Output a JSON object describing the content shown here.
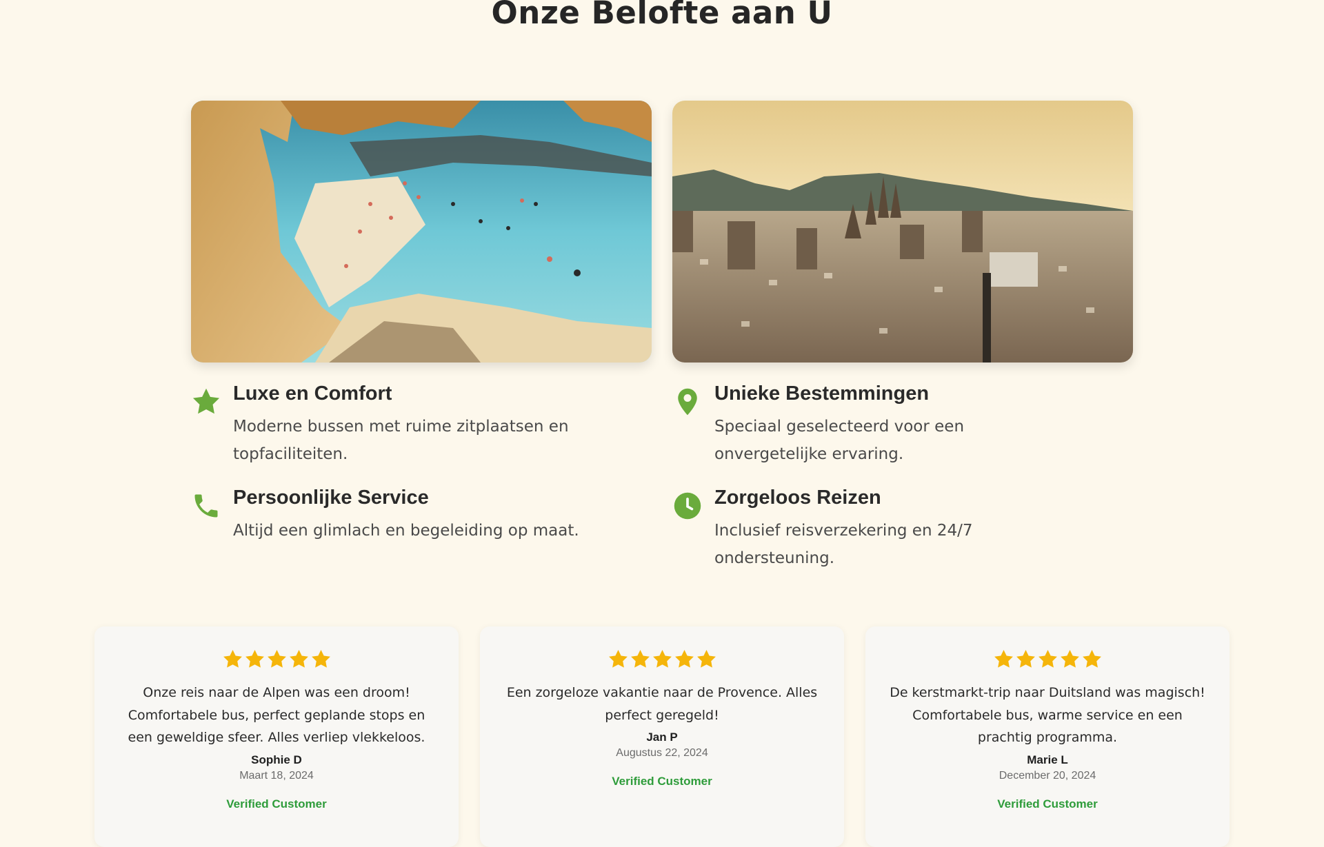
{
  "section": {
    "title": "Onze Belofte aan U"
  },
  "photos": [
    {
      "icon": "beach-cove-photo"
    },
    {
      "icon": "city-skyline-photo"
    }
  ],
  "features": [
    {
      "icon": "star-icon",
      "title": "Luxe en Comfort",
      "description": "Moderne bussen met ruime zitplaatsen en topfaciliteiten."
    },
    {
      "icon": "map-pin-icon",
      "title": "Unieke Bestemmingen",
      "description": "Speciaal geselecteerd voor een onvergetelijke ervaring."
    },
    {
      "icon": "phone-icon",
      "title": "Persoonlijke Service",
      "description": "Altijd een glimlach en begeleiding op maat."
    },
    {
      "icon": "clock-icon",
      "title": "Zorgeloos Reizen",
      "description": "Inclusief reisverzekering en 24/7 ondersteuning."
    }
  ],
  "reviews": [
    {
      "rating": 5,
      "text": "Onze reis naar de Alpen was een droom! Comfortabele bus, perfect geplande stops en een geweldige sfeer. Alles verliep vlekkeloos.",
      "name": "Sophie D",
      "date": "Maart 18, 2024",
      "badge": "Verified Customer"
    },
    {
      "rating": 5,
      "text": "Een zorgeloze vakantie naar de Provence. Alles perfect geregeld!",
      "name": "Jan P",
      "date": "Augustus 22, 2024",
      "badge": "Verified Customer"
    },
    {
      "rating": 5,
      "text": "De kerstmarkt-trip naar Duitsland was magisch! Comfortabele bus, warme service en een prachtig programma.",
      "name": "Marie L",
      "date": "December 20, 2024",
      "badge": "Verified Customer"
    }
  ],
  "colors": {
    "background": "#fdf8ec",
    "accent_green": "#6aab3c",
    "star_gold": "#f5b50a",
    "verified_green": "#2e9c3a"
  }
}
